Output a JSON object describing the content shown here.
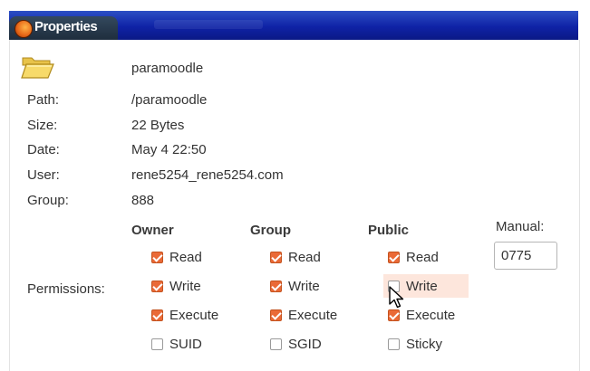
{
  "window": {
    "title": "Properties",
    "icon": "firefox-icon"
  },
  "file": {
    "icon": "folder-icon",
    "name": "paramoodle",
    "labels": {
      "path": "Path:",
      "size": "Size:",
      "date": "Date:",
      "user": "User:",
      "group": "Group:",
      "permissions": "Permissions:"
    },
    "values": {
      "path": "/paramoodle",
      "size": "22 Bytes",
      "date": "May 4 22:50",
      "user": "rene5254_rene5254.com",
      "group": "888"
    }
  },
  "permissions": {
    "columns": {
      "owner": "Owner",
      "group": "Group",
      "public": "Public"
    },
    "owner": [
      {
        "label": "Read",
        "checked": true
      },
      {
        "label": "Write",
        "checked": true
      },
      {
        "label": "Execute",
        "checked": true
      },
      {
        "label": "SUID",
        "checked": false
      }
    ],
    "group": [
      {
        "label": "Read",
        "checked": true
      },
      {
        "label": "Write",
        "checked": true
      },
      {
        "label": "Execute",
        "checked": true
      },
      {
        "label": "SGID",
        "checked": false
      }
    ],
    "public": [
      {
        "label": "Read",
        "checked": true
      },
      {
        "label": "Write",
        "checked": false
      },
      {
        "label": "Execute",
        "checked": true
      },
      {
        "label": "Sticky",
        "checked": false
      }
    ],
    "manual": {
      "label": "Manual:",
      "value": "0775"
    }
  },
  "colors": {
    "titlebar": "#0f22a6",
    "checkbox_checked": "#ea6a37",
    "hover_highlight": "#fde6dc"
  }
}
